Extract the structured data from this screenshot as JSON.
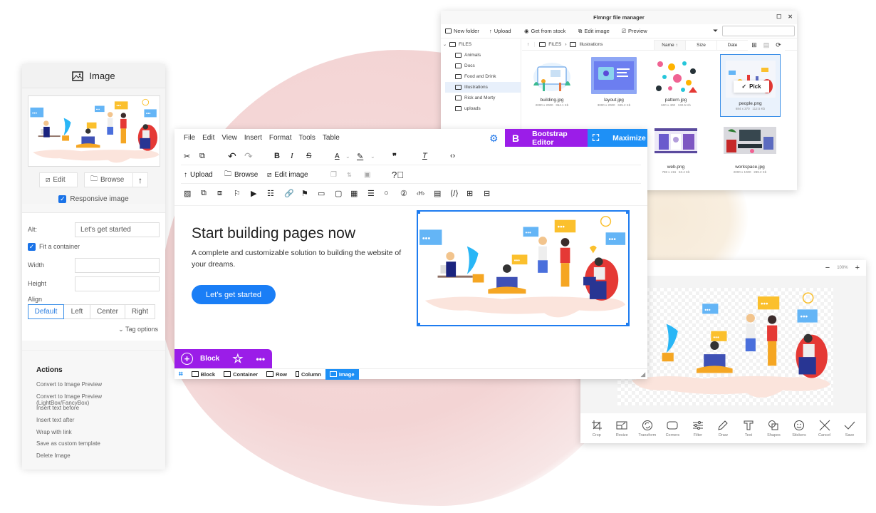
{
  "image_panel": {
    "title": "Image",
    "edit_label": "Edit",
    "browse_label": "Browse",
    "responsive_label": "Responsive image",
    "responsive_checked": true,
    "alt_label": "Alt:",
    "alt_value": "Let's get started",
    "fit_label": "Fit a container",
    "fit_checked": true,
    "width_label": "Width",
    "width_value": "",
    "height_label": "Height",
    "height_value": "",
    "align_label": "Align",
    "align_options": [
      "Default",
      "Left",
      "Center",
      "Right"
    ],
    "align_selected": "Default",
    "tag_options_label": "Tag options",
    "actions_title": "Actions",
    "actions": [
      "Convert to Image Preview",
      "Convert to Image Preview (LightBox/FancyBox)",
      "Insert text before",
      "Insert text after",
      "Wrap with link",
      "Save as custom template",
      "Delete Image"
    ]
  },
  "editor": {
    "menu": [
      "File",
      "Edit",
      "View",
      "Insert",
      "Format",
      "Tools",
      "Table"
    ],
    "bootstrap_label": "Bootstrap Editor",
    "maximize_label": "Maximize",
    "toolbar2": {
      "upload": "Upload",
      "browse": "Browse",
      "edit_image": "Edit image"
    },
    "content": {
      "heading": "Start building pages now",
      "paragraph": "A complete and customizable solution to building the website of your dreams.",
      "button": "Let's get started"
    },
    "block_label": "Block",
    "breadcrumbs": [
      "Block",
      "Container",
      "Row",
      "Column",
      "Image"
    ],
    "breadcrumb_active": "Image",
    "accent_purple": "#9b1de8",
    "accent_blue": "#1e90f6"
  },
  "file_manager": {
    "title": "Flmngr file manager",
    "toolbar": {
      "new_folder": "New folder",
      "upload": "Upload",
      "get_from_stock": "Get from stock",
      "edit_image": "Edit image",
      "preview": "Preview"
    },
    "search_value": "",
    "tree_root": "FILES",
    "folders": [
      "Animals",
      "Docs",
      "Food and Drink",
      "Illustrations",
      "Rick and Morty",
      "uploads"
    ],
    "selected_folder": "Illustrations",
    "path": [
      "FILES",
      "Illustrations"
    ],
    "columns": [
      "Name ↑",
      "Size",
      "Date"
    ],
    "pick_label": "Pick",
    "files": [
      {
        "name": "building.jpg",
        "dims": "2000 x 2000",
        "size": "364.1 Kb"
      },
      {
        "name": "layout.jpg",
        "dims": "3000 x 2000",
        "size": "345.2 Kb"
      },
      {
        "name": "pattern.jpg",
        "dims": "600 x 400",
        "size": "132.5 Kb"
      },
      {
        "name": "people.png",
        "dims": "684 x 370",
        "size": "112.5 Kb",
        "selected": true
      },
      {
        "name": "web.png",
        "dims": "788 x 416",
        "size": "63.4 Kb"
      },
      {
        "name": "workspace.jpg",
        "dims": "2000 x 1000",
        "size": "289.2 Kb"
      }
    ]
  },
  "image_editor": {
    "zoom": "100%",
    "tools": [
      "Crop",
      "Resize",
      "Transform",
      "Corners",
      "Filter",
      "Draw",
      "Text",
      "Shapes",
      "Stickers",
      "Cancel",
      "Save"
    ]
  }
}
